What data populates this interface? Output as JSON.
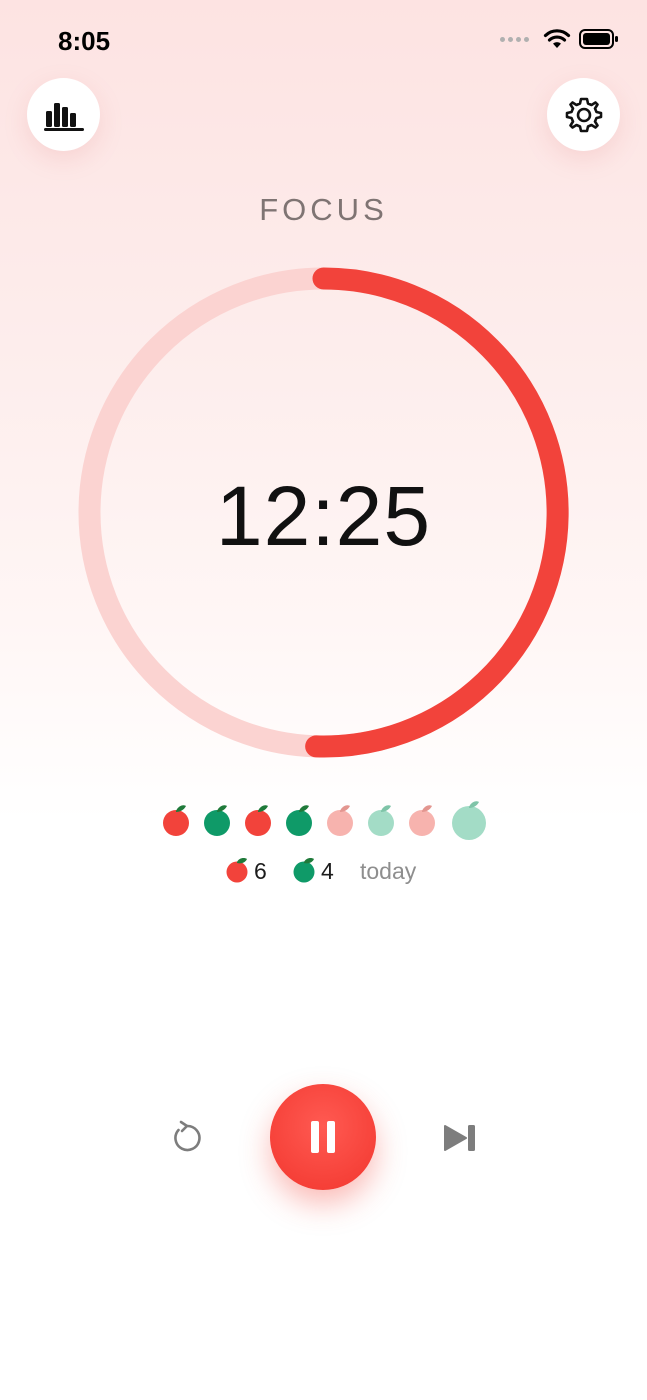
{
  "status_bar": {
    "time": "8:05",
    "icons": [
      "signal-dots-icon",
      "wifi-icon",
      "battery-icon"
    ]
  },
  "header": {
    "stats_icon": "bar-chart-icon",
    "settings_icon": "gear-icon"
  },
  "timer": {
    "mode": "FOCUS",
    "time_remaining": "12:25",
    "progress_fraction": 0.505
  },
  "session_dots": [
    {
      "type": "focus",
      "state": "done"
    },
    {
      "type": "break",
      "state": "done"
    },
    {
      "type": "focus",
      "state": "done"
    },
    {
      "type": "break",
      "state": "done"
    },
    {
      "type": "focus",
      "state": "pending"
    },
    {
      "type": "break",
      "state": "pending"
    },
    {
      "type": "focus",
      "state": "pending"
    },
    {
      "type": "break",
      "state": "pending-long"
    }
  ],
  "today": {
    "focus_count": "6",
    "break_count": "4",
    "label": "today"
  },
  "controls": {
    "reset_icon": "reset-icon",
    "pause_icon": "pause-icon",
    "skip_icon": "skip-next-icon"
  },
  "colors": {
    "accent_red": "#f2433b",
    "track_red": "#fbd3d1",
    "break_green": "#0f9a68",
    "pending_red": "#f7b3ae",
    "pending_green": "#a3dcc6",
    "leaf_green": "#1f7a3a"
  }
}
